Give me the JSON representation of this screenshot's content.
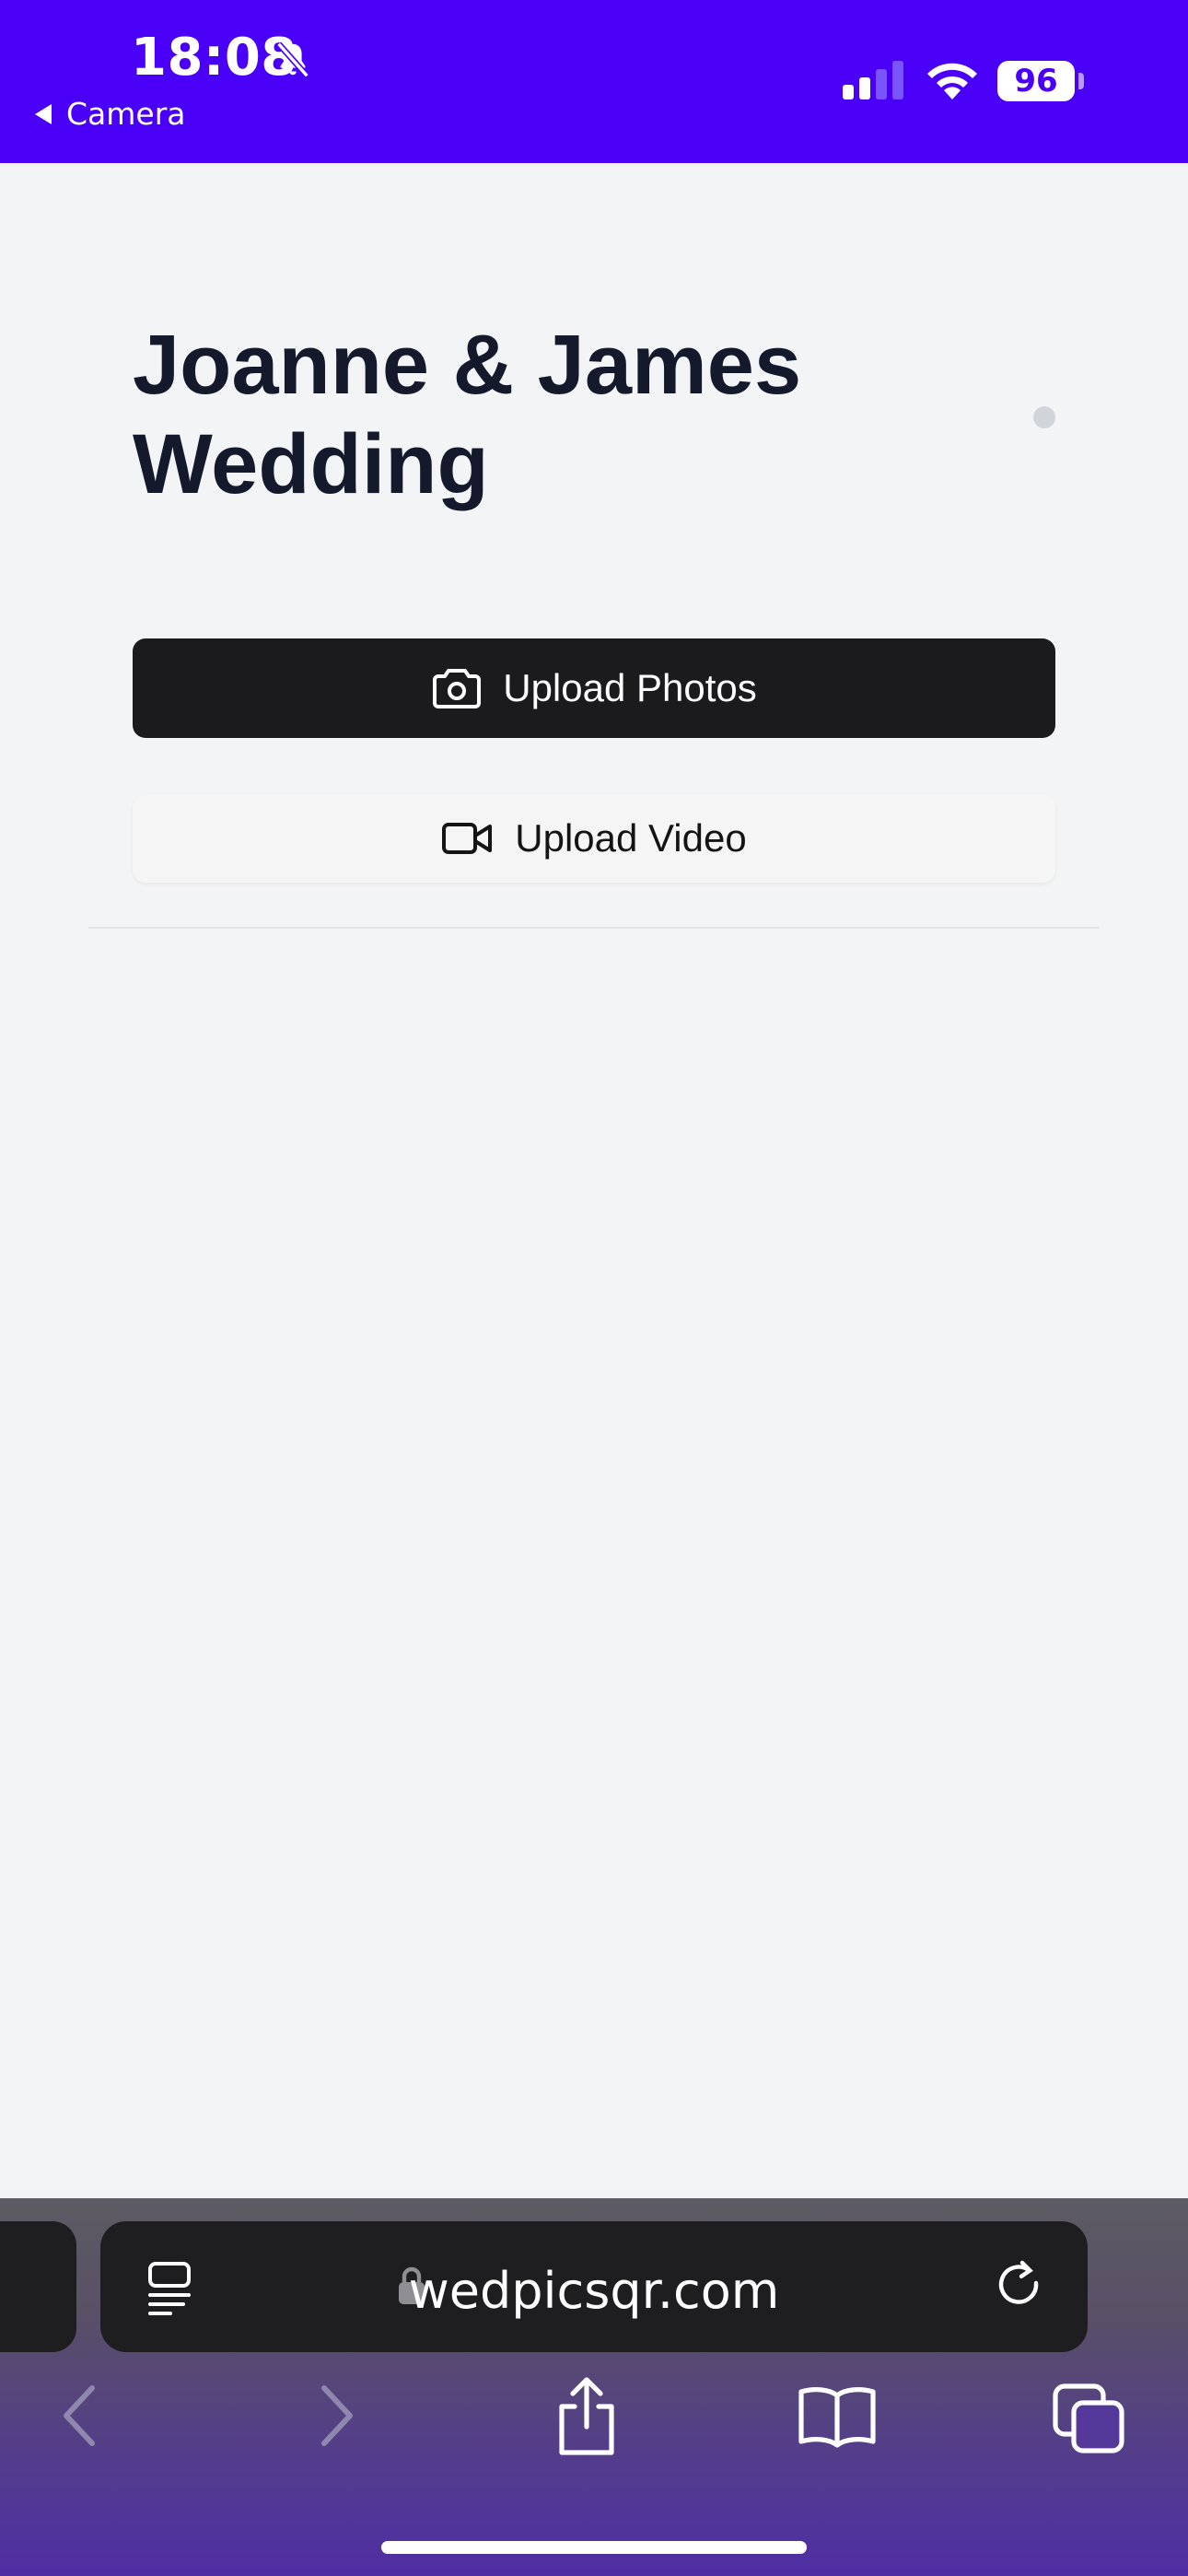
{
  "status_bar": {
    "time": "18:08",
    "back_label": "Camera",
    "battery": "96"
  },
  "page": {
    "title": "Joanne & James Wedding"
  },
  "actions": {
    "upload_photos": "Upload Photos",
    "upload_video": "Upload Video"
  },
  "browser": {
    "url": "wedpicsqr.com"
  },
  "colors": {
    "status_bar_bg": "#4a00f7",
    "primary_button": "#1b1b1d",
    "page_bg": "#f3f4f6"
  }
}
